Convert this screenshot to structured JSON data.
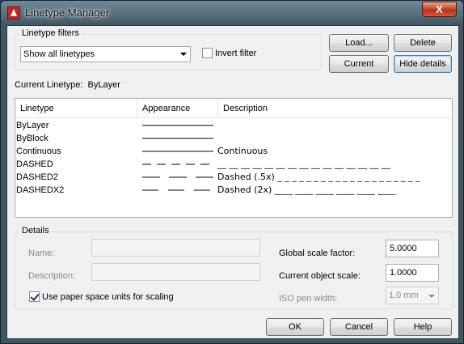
{
  "window": {
    "title": "Linetype Manager",
    "close_label": "X"
  },
  "filters": {
    "group_label": "Linetype filters",
    "selected": "Show all linetypes",
    "invert_label": "Invert filter",
    "invert_checked": false
  },
  "buttons": {
    "load": "Load...",
    "delete": "Delete",
    "current": "Current",
    "hide_details": "Hide details",
    "ok": "OK",
    "cancel": "Cancel",
    "help": "Help"
  },
  "current_linetype": {
    "label": "Current Linetype:",
    "value": "ByLayer"
  },
  "list": {
    "columns": [
      "Linetype",
      "Appearance",
      "Description"
    ],
    "rows": [
      {
        "name": "ByLayer",
        "description": "",
        "pattern": "solid"
      },
      {
        "name": "ByBlock",
        "description": "",
        "pattern": "solid"
      },
      {
        "name": "Continuous",
        "description": "Continuous",
        "pattern": "solid"
      },
      {
        "name": "DASHED",
        "description": "__ __ __ __ __ __ __ __ __ __ __ __ __ __ __",
        "pattern": "dashed"
      },
      {
        "name": "DASHED2",
        "description": "Dashed (.5x) _ _ _ _ _ _ _ _ _ _ _ _ _ _ _ _ _ _ _ _",
        "pattern": "dashed2"
      },
      {
        "name": "DASHEDX2",
        "description": "Dashed (2x) ____ ____ ____ ____ ____ ____",
        "pattern": "dashedx2"
      }
    ]
  },
  "details": {
    "group_label": "Details",
    "name_label": "Name:",
    "name_value": "",
    "description_label": "Description:",
    "description_value": "",
    "paper_space_label": "Use paper space units for scaling",
    "paper_space_checked": true,
    "global_scale_label": "Global scale factor:",
    "global_scale_value": "5.0000",
    "object_scale_label": "Current object scale:",
    "object_scale_value": "1.0000",
    "iso_pen_label": "ISO pen width:",
    "iso_pen_value": "1.0 mm"
  }
}
